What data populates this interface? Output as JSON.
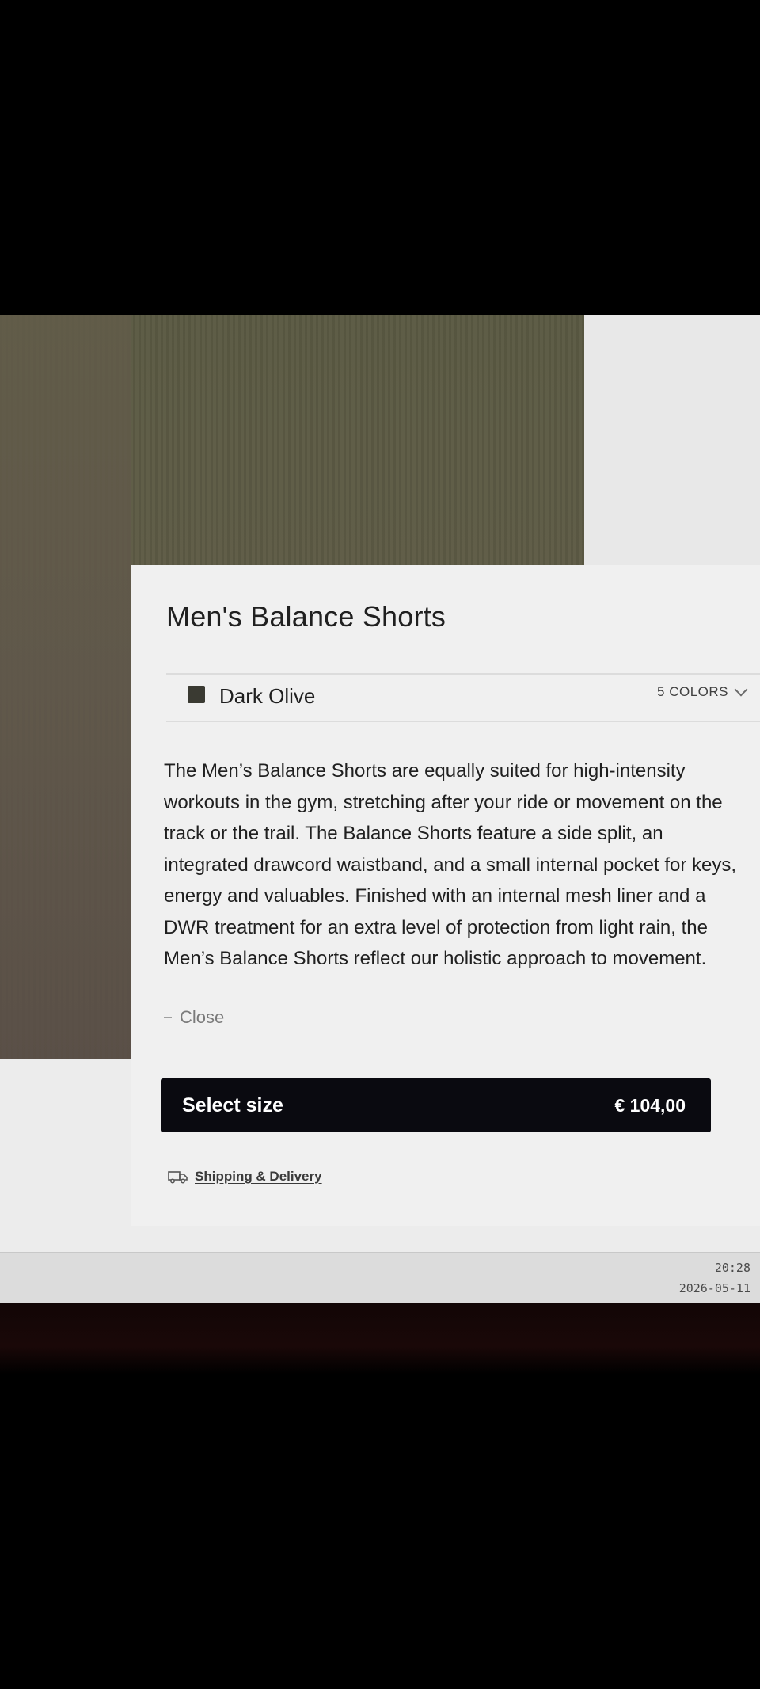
{
  "product": {
    "title": "Men's Balance Shorts",
    "color_name": "Dark Olive",
    "colors_count": "5 COLORS",
    "description": "The Men’s Balance Shorts are equally suited for high-intensity workouts in the gym, stretching after your ride or movement on the track or the trail. The Balance Shorts feature a side split, an integrated drawcord waistband, and a small internal pocket for keys, energy and valuables. Finished with an internal mesh liner and a DWR treatment for an extra level of protection from light rain, the Men’s Balance Shorts reflect our holistic approach to movement.",
    "close_label": "Close"
  },
  "cta": {
    "label": "Select size",
    "price": "€ 104,00"
  },
  "shipping": {
    "label": "Shipping & Delivery",
    "icon": "truck-icon"
  },
  "taskbar": {
    "time": "20:28",
    "date": "2026-05-11"
  },
  "colors": {
    "swatch": "#3a3a32",
    "button_bg": "#0a0a10",
    "photo": "#5b5a43"
  }
}
